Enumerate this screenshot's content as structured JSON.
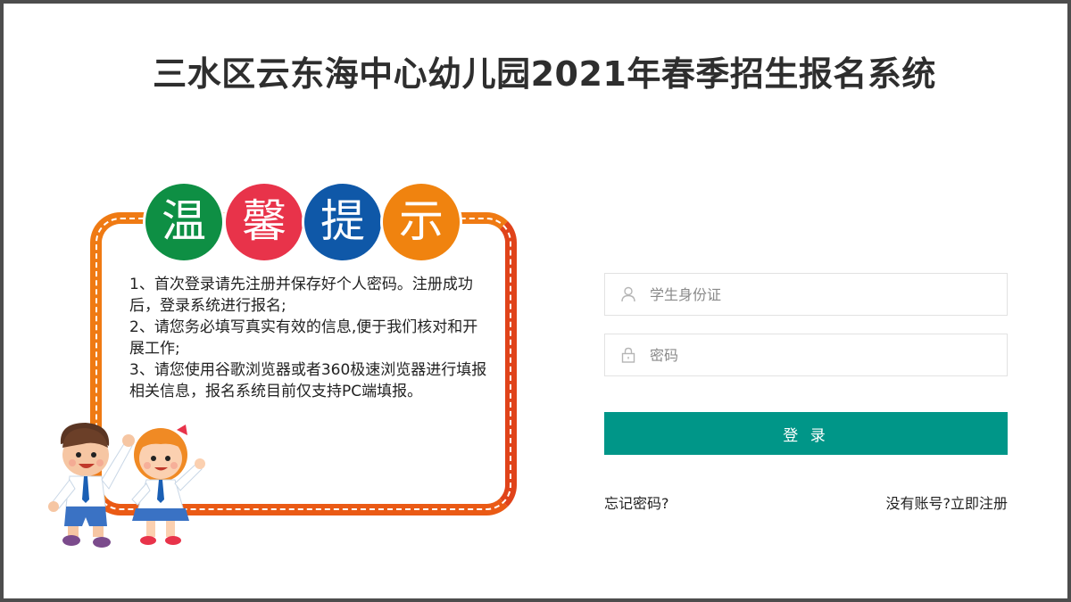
{
  "page": {
    "title": "三水区云东海中心幼儿园2021年春季招生报名系统"
  },
  "notice": {
    "badges": [
      {
        "char": "温",
        "color": "#0e8f44"
      },
      {
        "char": "馨",
        "color": "#e8334a"
      },
      {
        "char": "提",
        "color": "#0f58a8"
      },
      {
        "char": "示",
        "color": "#f0830f"
      }
    ],
    "tips": [
      "1、首次登录请先注册并保存好个人密码。注册成功后，登录系统进行报名;",
      "2、请您务必填写真实有效的信息,便于我们核对和开展工作;",
      "3、请您使用谷歌浏览器或者360极速浏览器进行填报相关信息，报名系统目前仅支持PC端填报。"
    ]
  },
  "login": {
    "id_placeholder": "学生身份证",
    "id_value": "",
    "password_placeholder": "密码",
    "password_value": "",
    "submit_label": "登 录",
    "forgot_label": "忘记密码?",
    "register_label": "没有账号?立即注册",
    "accent_color": "#009688"
  },
  "icons": {
    "id_field_icon": "user-icon",
    "password_field_icon": "lock-icon"
  }
}
